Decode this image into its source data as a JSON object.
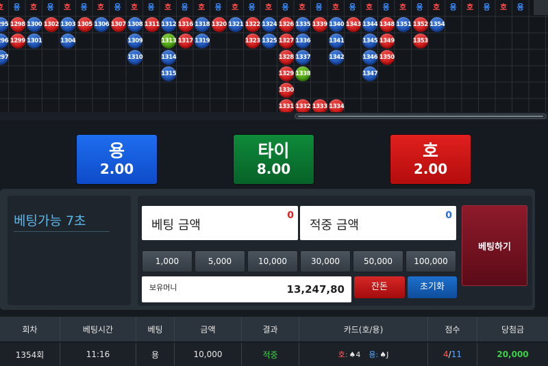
{
  "road": {
    "headers": [
      "호",
      "용",
      "호",
      "용",
      "호",
      "용",
      "호",
      "용",
      "호",
      "용",
      "호",
      "용",
      "호",
      "용",
      "호",
      "용",
      "호",
      "용",
      "호",
      "용",
      "호",
      "용",
      "호",
      "용",
      "호",
      "용",
      "호",
      "용",
      "호",
      "용",
      "호",
      "용"
    ],
    "beads": [
      {
        "n": "1295",
        "c": "blue",
        "col": 0,
        "row": 0
      },
      {
        "n": "1296",
        "c": "blue",
        "col": 0,
        "row": 1
      },
      {
        "n": "1297",
        "c": "blue",
        "col": 0,
        "row": 2
      },
      {
        "n": "1298",
        "c": "red",
        "col": 1,
        "row": 0
      },
      {
        "n": "1299",
        "c": "red",
        "col": 1,
        "row": 1
      },
      {
        "n": "1300",
        "c": "blue",
        "col": 2,
        "row": 0
      },
      {
        "n": "1301",
        "c": "blue",
        "col": 2,
        "row": 1
      },
      {
        "n": "1302",
        "c": "red",
        "col": 3,
        "row": 0
      },
      {
        "n": "1303",
        "c": "blue",
        "col": 4,
        "row": 0
      },
      {
        "n": "1304",
        "c": "blue",
        "col": 4,
        "row": 1
      },
      {
        "n": "1305",
        "c": "red",
        "col": 5,
        "row": 0
      },
      {
        "n": "1306",
        "c": "blue",
        "col": 6,
        "row": 0
      },
      {
        "n": "1307",
        "c": "red",
        "col": 7,
        "row": 0
      },
      {
        "n": "1308",
        "c": "blue",
        "col": 8,
        "row": 0
      },
      {
        "n": "1309",
        "c": "blue",
        "col": 8,
        "row": 1
      },
      {
        "n": "1310",
        "c": "blue",
        "col": 8,
        "row": 2
      },
      {
        "n": "1311",
        "c": "red",
        "col": 9,
        "row": 0
      },
      {
        "n": "1312",
        "c": "blue",
        "col": 10,
        "row": 0
      },
      {
        "n": "1313",
        "c": "green",
        "col": 10,
        "row": 1
      },
      {
        "n": "1314",
        "c": "blue",
        "col": 10,
        "row": 2
      },
      {
        "n": "1315",
        "c": "blue",
        "col": 10,
        "row": 3
      },
      {
        "n": "1316",
        "c": "red",
        "col": 11,
        "row": 0
      },
      {
        "n": "1317",
        "c": "red",
        "col": 11,
        "row": 1
      },
      {
        "n": "1318",
        "c": "blue",
        "col": 12,
        "row": 0
      },
      {
        "n": "1319",
        "c": "blue",
        "col": 12,
        "row": 1
      },
      {
        "n": "1320",
        "c": "red",
        "col": 13,
        "row": 0
      },
      {
        "n": "1321",
        "c": "blue",
        "col": 14,
        "row": 0
      },
      {
        "n": "1322",
        "c": "red",
        "col": 15,
        "row": 0
      },
      {
        "n": "1323",
        "c": "red",
        "col": 15,
        "row": 1
      },
      {
        "n": "1324",
        "c": "blue",
        "col": 16,
        "row": 0
      },
      {
        "n": "1325",
        "c": "blue",
        "col": 16,
        "row": 1
      },
      {
        "n": "1326",
        "c": "red",
        "col": 17,
        "row": 0
      },
      {
        "n": "1327",
        "c": "red",
        "col": 17,
        "row": 1
      },
      {
        "n": "1328",
        "c": "red",
        "col": 17,
        "row": 2
      },
      {
        "n": "1329",
        "c": "red",
        "col": 17,
        "row": 3
      },
      {
        "n": "1330",
        "c": "red",
        "col": 17,
        "row": 4
      },
      {
        "n": "1331",
        "c": "red",
        "col": 17,
        "row": 5
      },
      {
        "n": "1332",
        "c": "red",
        "col": 18,
        "row": 5
      },
      {
        "n": "1333",
        "c": "red",
        "col": 19,
        "row": 5
      },
      {
        "n": "1334",
        "c": "red",
        "col": 20,
        "row": 5
      },
      {
        "n": "1335",
        "c": "blue",
        "col": 18,
        "row": 0
      },
      {
        "n": "1336",
        "c": "blue",
        "col": 18,
        "row": 1
      },
      {
        "n": "1337",
        "c": "blue",
        "col": 18,
        "row": 2
      },
      {
        "n": "1338",
        "c": "green",
        "col": 18,
        "row": 3
      },
      {
        "n": "1339",
        "c": "red",
        "col": 19,
        "row": 0
      },
      {
        "n": "1340",
        "c": "blue",
        "col": 20,
        "row": 0
      },
      {
        "n": "1341",
        "c": "blue",
        "col": 20,
        "row": 1
      },
      {
        "n": "1342",
        "c": "blue",
        "col": 20,
        "row": 2
      },
      {
        "n": "1343",
        "c": "red",
        "col": 21,
        "row": 0
      },
      {
        "n": "1344",
        "c": "blue",
        "col": 22,
        "row": 0
      },
      {
        "n": "1345",
        "c": "blue",
        "col": 22,
        "row": 1
      },
      {
        "n": "1346",
        "c": "blue",
        "col": 22,
        "row": 2
      },
      {
        "n": "1347",
        "c": "blue",
        "col": 22,
        "row": 3
      },
      {
        "n": "1348",
        "c": "red",
        "col": 23,
        "row": 0
      },
      {
        "n": "1349",
        "c": "red",
        "col": 23,
        "row": 1
      },
      {
        "n": "1350",
        "c": "red",
        "col": 23,
        "row": 2
      },
      {
        "n": "1351",
        "c": "blue",
        "col": 24,
        "row": 0
      },
      {
        "n": "1352",
        "c": "red",
        "col": 25,
        "row": 0
      },
      {
        "n": "1353",
        "c": "red",
        "col": 25,
        "row": 1
      },
      {
        "n": "1354",
        "c": "blue",
        "col": 26,
        "row": 0
      }
    ]
  },
  "bets": {
    "dragon": {
      "name": "용",
      "odds": "2.00"
    },
    "tie": {
      "name": "타이",
      "odds": "8.00"
    },
    "tiger": {
      "name": "호",
      "odds": "2.00"
    }
  },
  "timer": {
    "text": "베팅가능 7초"
  },
  "form": {
    "bet_amount_label": "베팅 금액",
    "bet_amount_value": "0",
    "win_amount_label": "적중 금액",
    "win_amount_value": "0",
    "chips": [
      "1,000",
      "5,000",
      "10,000",
      "30,000",
      "50,000",
      "100,000"
    ],
    "balance_label": "보유머니",
    "balance_value": "13,247,80",
    "change_label": "잔돈",
    "reset_label": "초기화",
    "place_label": "베팅하기"
  },
  "history": {
    "headers": [
      "회차",
      "베팅시간",
      "베팅",
      "금액",
      "결과",
      "카드(호/용)",
      "점수",
      "당첨금"
    ],
    "row": {
      "round": "1354회",
      "time": "11:16",
      "bet": "용",
      "amount": "10,000",
      "result": "적중",
      "card_tiger_label": "호:",
      "card_tiger": "♠4",
      "card_dragon_label": "용:",
      "card_dragon": "♠J",
      "score_tiger": "4",
      "score_sep": "/",
      "score_dragon": "11",
      "payout": "20,000"
    }
  },
  "colors": {
    "dragon": "#1e6ef0",
    "tie": "#0e8a3a",
    "tiger": "#e0201e"
  }
}
